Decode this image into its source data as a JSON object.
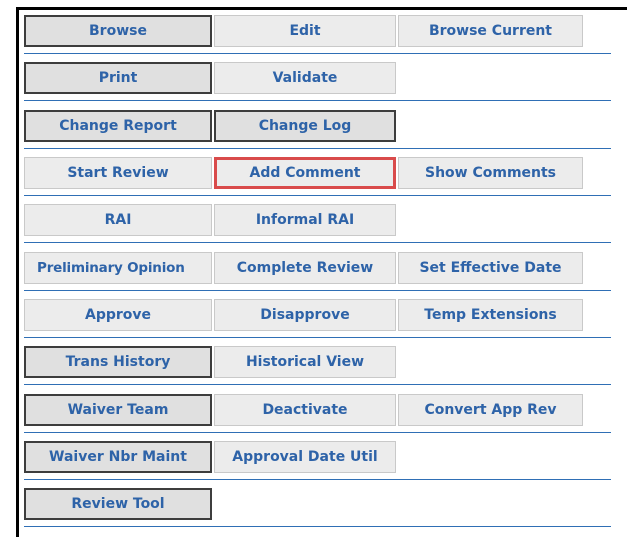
{
  "frame": {
    "color": "#000000",
    "accent": "#2f6fb5"
  },
  "rows": [
    {
      "buttons": [
        "Browse",
        "Edit",
        "Browse Current"
      ]
    },
    {
      "buttons": [
        "Print",
        "Validate"
      ]
    },
    {
      "buttons": [
        "Change Report",
        "Change Log"
      ]
    },
    {
      "buttons": [
        "Start Review",
        "Add Comment",
        "Show Comments"
      ],
      "highlighted": "Add Comment"
    },
    {
      "buttons": [
        "RAI",
        "Informal RAI"
      ]
    },
    {
      "buttons": [
        "Preliminary Opinion",
        "Complete Review",
        "Set Effective Date"
      ]
    },
    {
      "buttons": [
        "Approve",
        "Disapprove",
        "Temp Extensions"
      ]
    },
    {
      "buttons": [
        "Trans History",
        "Historical View"
      ]
    },
    {
      "buttons": [
        "Waiver Team",
        "Deactivate",
        "Convert App Rev"
      ]
    },
    {
      "buttons": [
        "Waiver Nbr Maint",
        "Approval Date Util"
      ]
    },
    {
      "buttons": [
        "Review Tool"
      ]
    }
  ],
  "colors": {
    "button_text": "#2e63a8",
    "button_bg": "#ececec",
    "dark_border": "#3d3d3d",
    "highlight_border": "#d94b4b",
    "row_divider": "#2f6fb5"
  }
}
